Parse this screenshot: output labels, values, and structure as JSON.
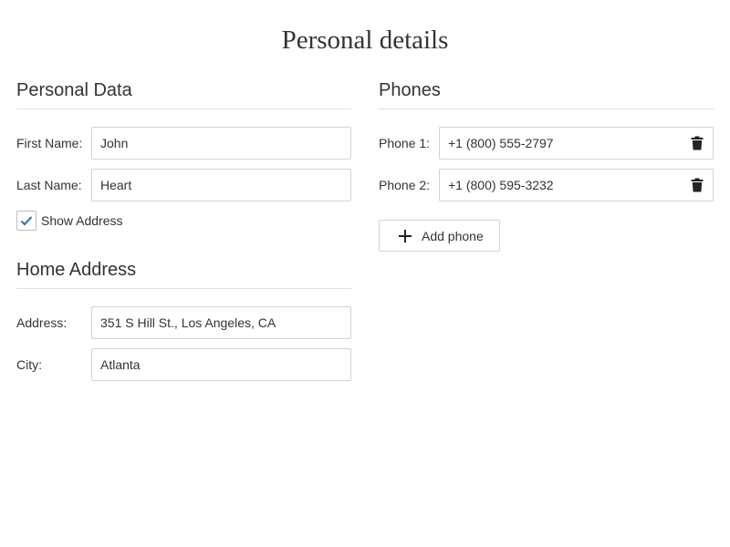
{
  "page": {
    "title": "Personal details"
  },
  "personal_data": {
    "heading": "Personal Data",
    "first_name": {
      "label": "First Name:",
      "value": "John"
    },
    "last_name": {
      "label": "Last Name:",
      "value": "Heart"
    },
    "show_address": {
      "label": "Show Address",
      "checked": true
    }
  },
  "home_address": {
    "heading": "Home Address",
    "address": {
      "label": "Address:",
      "value": "351 S Hill St., Los Angeles, CA"
    },
    "city": {
      "label": "City:",
      "value": "Atlanta"
    }
  },
  "phones": {
    "heading": "Phones",
    "items": [
      {
        "label": "Phone 1:",
        "value": "+1 (800) 555-2797",
        "icon": "trash-icon"
      },
      {
        "label": "Phone 2:",
        "value": "+1 (800) 595-3232",
        "icon": "trash-icon"
      }
    ],
    "add_button": {
      "label": "Add phone",
      "icon": "plus-icon"
    }
  },
  "colors": {
    "text": "#333333",
    "border": "#d3d3d3",
    "divider": "#e0e0e0",
    "check": "#337ab7"
  }
}
